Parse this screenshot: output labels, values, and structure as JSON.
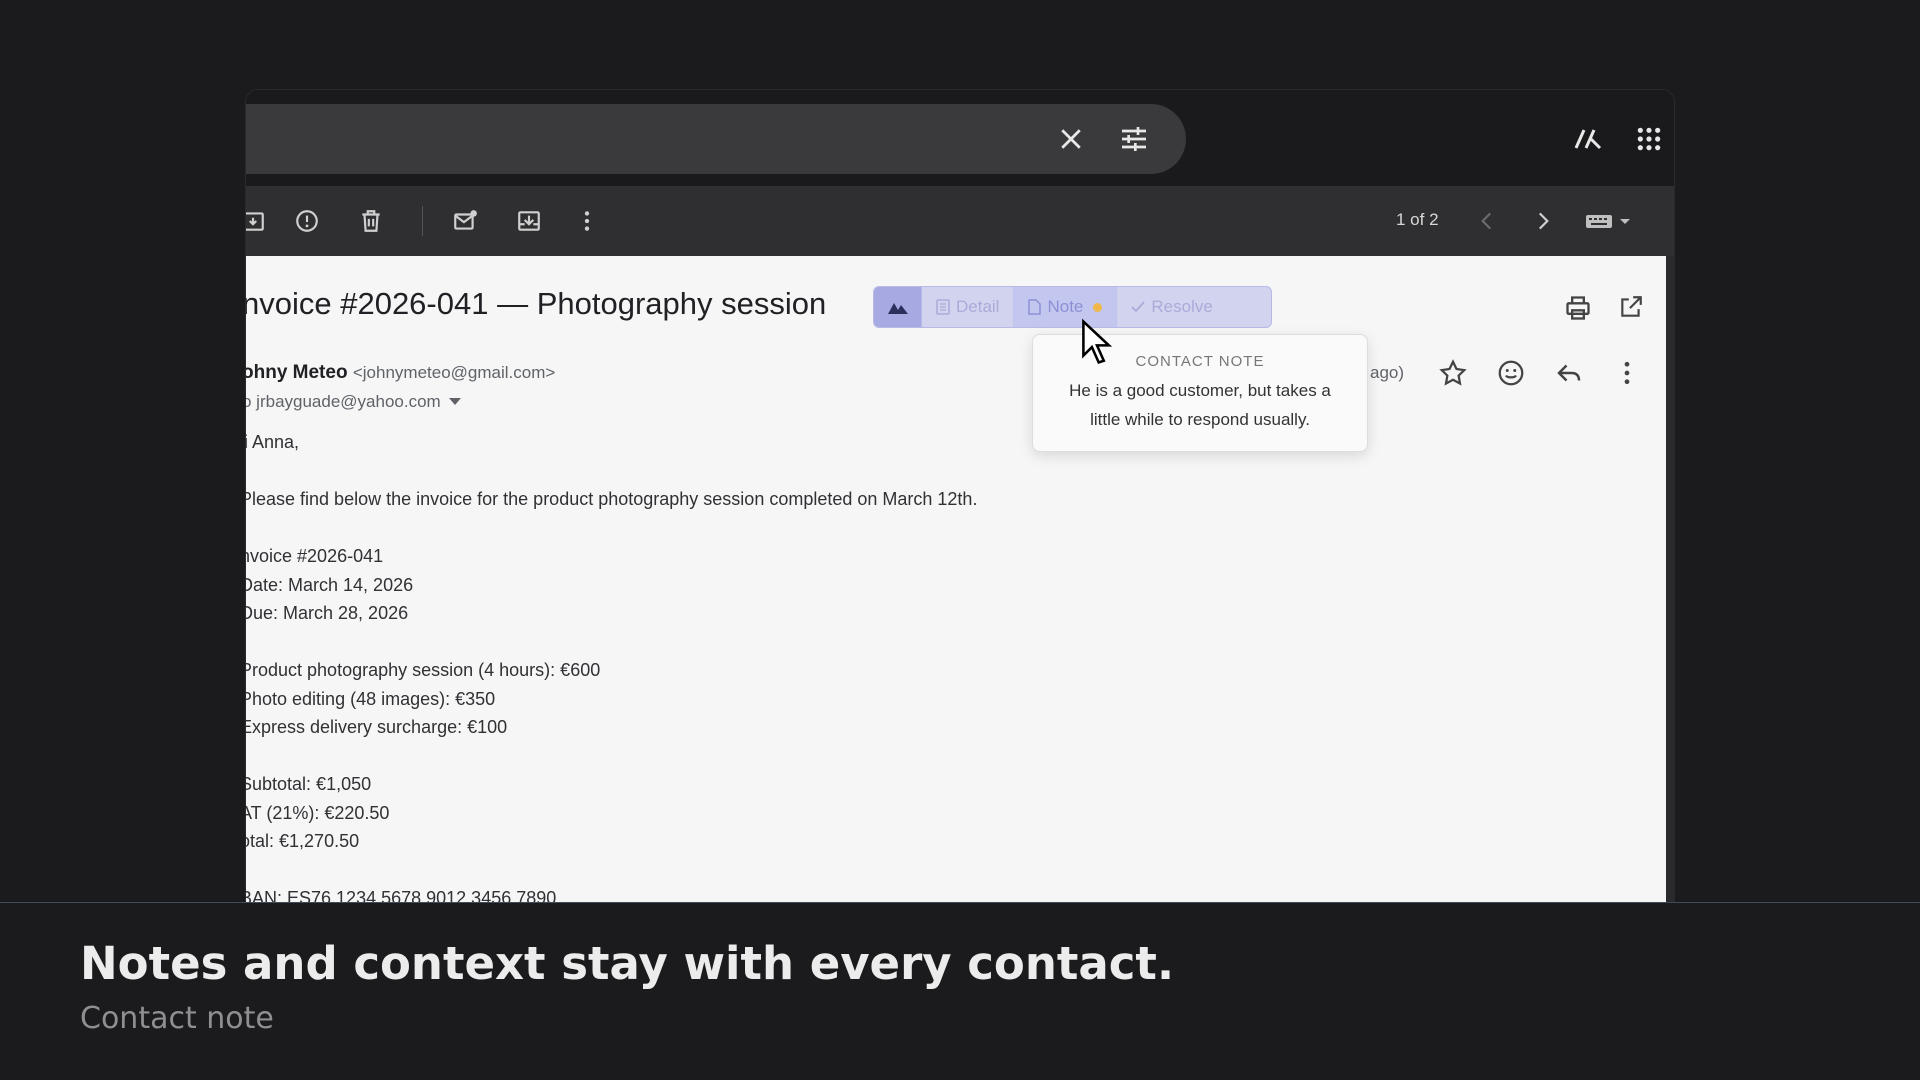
{
  "toolbar": {
    "pager": "1 of 2"
  },
  "ext": {
    "detail": "Detail",
    "note": "Note",
    "resolve": "Resolve"
  },
  "email": {
    "subject": "nvoice #2026-041 — Photography session",
    "sender_name": "ohny Meteo",
    "sender_email": "<johnymeteo@gmail.com>",
    "to": "o jrbayguade@yahoo.com",
    "time_suffix": "ago)",
    "body": [
      "li Anna,",
      "Please find below the invoice for the product photography session completed on March 12th.",
      "nvoice #2026-041",
      "Date: March 14, 2026",
      "Due: March 28, 2026",
      "Product photography session (4 hours): €600",
      "Photo editing (48 images): €350",
      "Express delivery surcharge: €100",
      "Subtotal: €1,050",
      "AT (21%): €220.50",
      "otal: €1,270.50",
      "BAN: ES76 1234 5678 9012 3456 7890"
    ]
  },
  "tooltip": {
    "heading": "CONTACT NOTE",
    "text": "He is a good customer, but takes a little while to respond usually."
  },
  "caption": {
    "title": "Notes and context stay with every contact.",
    "subtitle": "Contact note"
  }
}
